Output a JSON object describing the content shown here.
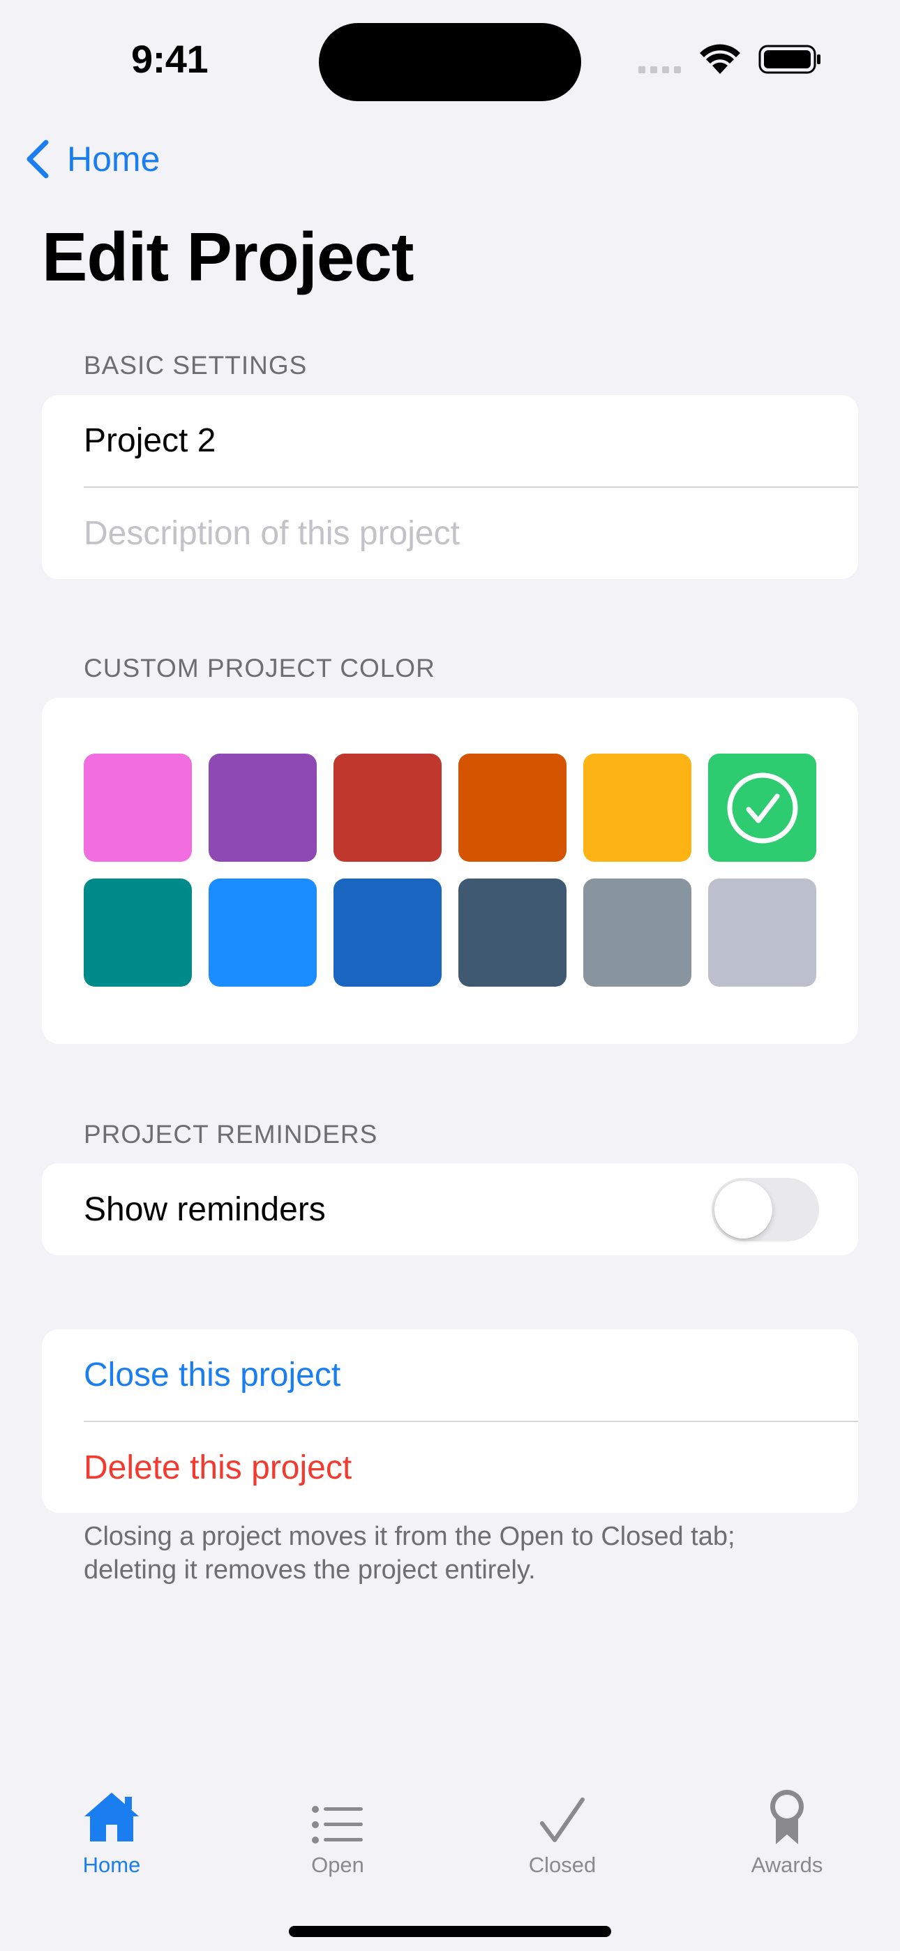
{
  "status_bar": {
    "time": "9:41"
  },
  "nav": {
    "back_label": "Home",
    "title": "Edit Project"
  },
  "basic_settings": {
    "header": "BASIC SETTINGS",
    "name_value": "Project 2",
    "description_placeholder": "Description of this project",
    "description_value": ""
  },
  "color_section": {
    "header": "CUSTOM PROJECT COLOR",
    "swatches": [
      {
        "name": "pink",
        "color": "#f26ee0",
        "selected": false
      },
      {
        "name": "purple",
        "color": "#8e49b5",
        "selected": false
      },
      {
        "name": "red",
        "color": "#c0382d",
        "selected": false
      },
      {
        "name": "orange",
        "color": "#d55400",
        "selected": false
      },
      {
        "name": "yellow",
        "color": "#feb314",
        "selected": false
      },
      {
        "name": "green",
        "color": "#2ecc71",
        "selected": true
      },
      {
        "name": "teal",
        "color": "#008b8b",
        "selected": false
      },
      {
        "name": "light-blue",
        "color": "#1b8dff",
        "selected": false
      },
      {
        "name": "dark-blue",
        "color": "#1a65c0",
        "selected": false
      },
      {
        "name": "dark-gray",
        "color": "#3e5971",
        "selected": false
      },
      {
        "name": "gray",
        "color": "#88949e",
        "selected": false
      },
      {
        "name": "midnight-gray",
        "color": "#bcc0cc",
        "selected": false
      }
    ]
  },
  "reminders": {
    "header": "PROJECT REMINDERS",
    "toggle_label": "Show reminders",
    "enabled": false
  },
  "actions": {
    "close_label": "Close this project",
    "delete_label": "Delete this project",
    "footer": "Closing a project moves it from the Open to Closed tab; deleting it removes the project entirely."
  },
  "tab_bar": {
    "items": [
      {
        "label": "Home",
        "icon": "house-icon",
        "active": true
      },
      {
        "label": "Open",
        "icon": "list-icon",
        "active": false
      },
      {
        "label": "Closed",
        "icon": "checkmark-icon",
        "active": false
      },
      {
        "label": "Awards",
        "icon": "rosette-icon",
        "active": false
      }
    ]
  },
  "colors": {
    "accent": "#1a7ef0",
    "destructive": "#f23a2f",
    "background": "#f2f2f7"
  }
}
